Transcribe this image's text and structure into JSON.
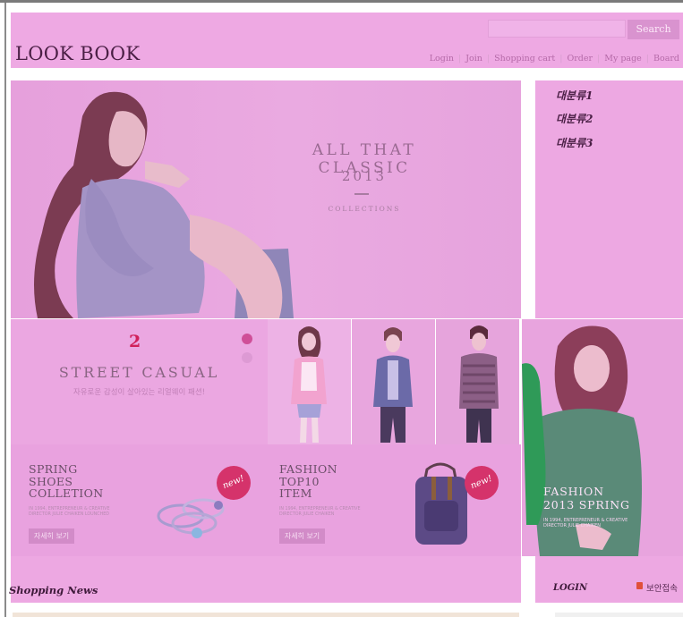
{
  "header": {
    "logo": "LOOK BOOK",
    "search_placeholder": "",
    "search_button": "Search",
    "nav": [
      "Login",
      "Join",
      "Shopping cart",
      "Order",
      "My page",
      "Board"
    ],
    "background": "#eea9e3"
  },
  "hero": {
    "title": "ALL THAT CLASSIC",
    "year": "2013",
    "subtitle": "COLLECTIONS"
  },
  "sidebar": {
    "items": [
      "대분류1",
      "대분류2",
      "대분류3"
    ]
  },
  "street_casual": {
    "number": "2",
    "title": "STREET CASUAL",
    "subtitle": "자유로운 감성이 살아있는 리얼웨이 패션!",
    "active_slide": 1,
    "slide_count": 2
  },
  "promos": [
    {
      "title_lines": [
        "SPRING",
        "SHOES",
        "COLLETION"
      ],
      "small_lines": [
        "IN 1994, ENTREPRENEUR & CREATIVE",
        "DIRECTOR JULIE CHAIKEN LOUNCHED"
      ],
      "button": "자세히 보기",
      "badge": "new!",
      "icon": "rings-icon"
    },
    {
      "title_lines": [
        "FASHION",
        "TOP10",
        "ITEM"
      ],
      "small_lines": [
        "IN 1994, ENTREPRENEUR & CREATIVE",
        "DIRECTOR JULIE CHAIKEN"
      ],
      "button": "자세히 보기",
      "badge": "new!",
      "icon": "backpack-icon"
    }
  ],
  "feature": {
    "title_lines": [
      "FASHION",
      "2013 SPRING"
    ],
    "small_lines": [
      "IN 1994, ENTREPRENEUR & CREATIVE",
      "DIRECTOR JULIE CHAIKEN"
    ]
  },
  "footer": {
    "news_label": "Shopping News",
    "login_label": "LOGIN",
    "secure_label": "보안접속"
  },
  "colors": {
    "overlay": "#eba7e1",
    "accent_red": "#d0205a",
    "dark_text": "#4a1f45"
  }
}
